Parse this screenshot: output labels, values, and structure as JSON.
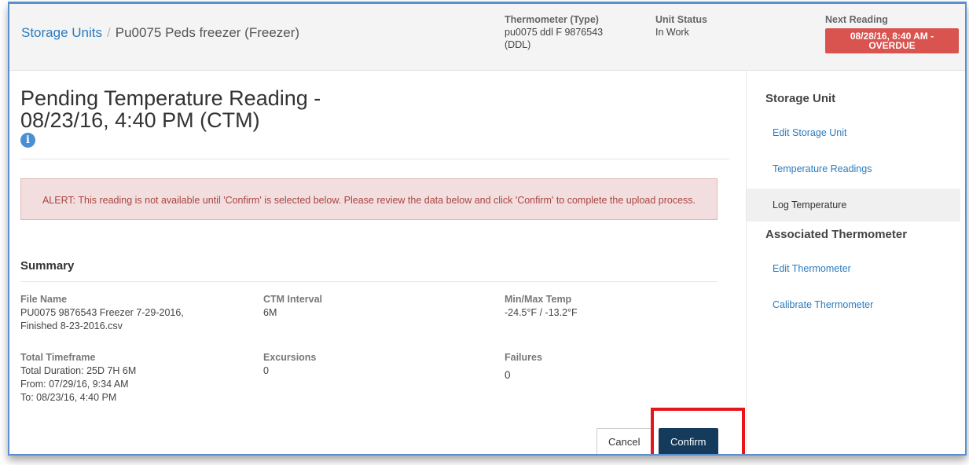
{
  "breadcrumb": {
    "root": "Storage Units",
    "separator": "/",
    "current": "Pu0075 Peds freezer (Freezer)"
  },
  "header": {
    "thermometer_label": "Thermometer (Type)",
    "thermometer_value": "pu0075 ddl F 9876543 (DDL)",
    "status_label": "Unit Status",
    "status_value": "In Work",
    "next_label": "Next Reading",
    "next_value": "08/28/16, 8:40 AM - OVERDUE",
    "overdue_color": "#d9534f"
  },
  "page": {
    "title_line1": "Pending Temperature Reading -",
    "title_line2": "08/23/16, 4:40 PM (CTM)",
    "info_icon": "i"
  },
  "alert": {
    "text": "ALERT: This reading is not available until 'Confirm' is selected below. Please review the data below and click 'Confirm' to complete the upload process."
  },
  "summary": {
    "title": "Summary",
    "file_name_label": "File Name",
    "file_name_value": "PU0075 9876543 Freezer 7-29-2016, Finished 8-23-2016.csv",
    "interval_label": "CTM Interval",
    "interval_value": "6M",
    "minmax_label": "Min/Max Temp",
    "minmax_value": "-24.5°F / -13.2°F",
    "timeframe_label": "Total Timeframe",
    "timeframe_duration": "Total Duration: 25D 7H 6M",
    "timeframe_from": "From: 07/29/16, 9:34 AM",
    "timeframe_to": "To: 08/23/16, 4:40 PM",
    "excursions_label": "Excursions",
    "excursions_value": "0",
    "failures_label": "Failures",
    "failures_value": "0"
  },
  "buttons": {
    "cancel": "Cancel",
    "confirm": "Confirm"
  },
  "sidebar": {
    "storage_heading": "Storage Unit",
    "storage_items": [
      "Edit Storage Unit",
      "Temperature Readings",
      "Log Temperature"
    ],
    "thermo_heading": "Associated Thermometer",
    "thermo_items": [
      "Edit Thermometer",
      "Calibrate Thermometer"
    ]
  },
  "colors": {
    "link": "#2a7bbf",
    "primary_button": "#143a5c",
    "highlight": "#e8141b",
    "alert_bg": "#f2dede"
  }
}
